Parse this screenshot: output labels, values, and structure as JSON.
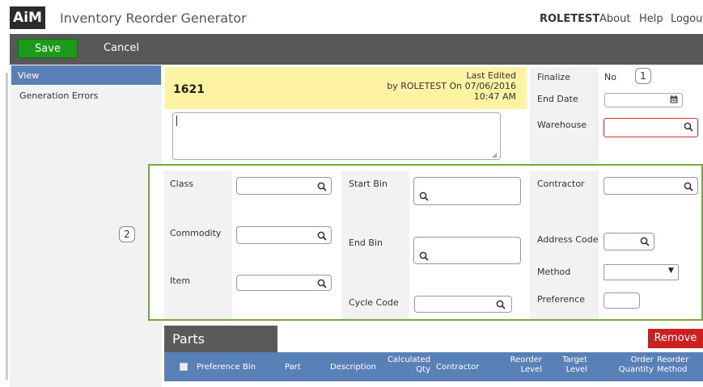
{
  "header": {
    "logo": "AiM",
    "title": "Inventory Reorder Generator",
    "nav": {
      "user": "ROLETEST",
      "about": "About",
      "help": "Help",
      "logout": "Logout"
    }
  },
  "toolbar": {
    "save_label": "Save",
    "cancel_label": "Cancel"
  },
  "sidebar": {
    "items": [
      {
        "label": "View",
        "active": true
      },
      {
        "label": "Generation Errors",
        "active": false
      }
    ]
  },
  "callouts": {
    "one": "1",
    "two": "2"
  },
  "record": {
    "id": "1621",
    "last_edited_line1": "Last Edited",
    "last_edited_line2": "by ROLETEST On 07/06/2016",
    "last_edited_line3": "10:47 AM",
    "notes_value": ""
  },
  "right_panel": {
    "finalize_label": "Finalize",
    "finalize_value": "No",
    "end_date_label": "End Date",
    "end_date_value": "",
    "warehouse_label": "Warehouse",
    "warehouse_value": ""
  },
  "criteria": {
    "class_label": "Class",
    "commodity_label": "Commodity",
    "item_label": "Item",
    "start_bin_label": "Start Bin",
    "end_bin_label": "End Bin",
    "cycle_code_label": "Cycle Code",
    "contractor_label": "Contractor",
    "address_code_label": "Address Code",
    "method_label": "Method",
    "method_value": "",
    "preference_label": "Preference"
  },
  "parts": {
    "tab_label": "Parts",
    "remove_label": "Remove",
    "columns": {
      "preference": "Preference",
      "bin": "Bin",
      "part": "Part",
      "description": "Description",
      "calculated_1": "Calculated",
      "calculated_2": "Qty",
      "contractor": "Contractor",
      "reorder_1": "Reorder",
      "reorder_2": "Level",
      "target_1": "Target",
      "target_2": "Level",
      "order_1": "Order",
      "order_2": "Quantity",
      "method_1": "Reorder",
      "method_2": "Method"
    }
  },
  "colors": {
    "save": "#1b9a1b",
    "remove": "#cc2020",
    "accent": "#5a80b8",
    "highlight": "#fdf3a3",
    "criteria_border": "#77a83e",
    "required": "#d33333"
  }
}
